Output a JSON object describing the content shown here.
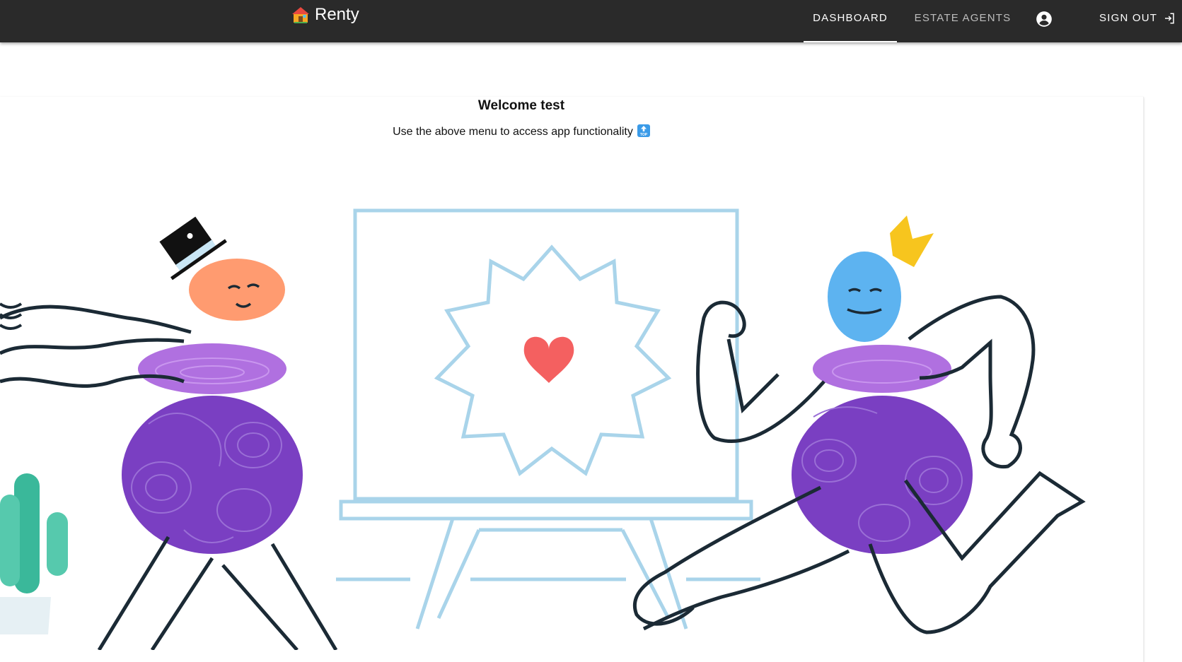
{
  "appbar": {
    "brand": "Renty",
    "brand_icon": "house-emoji",
    "tabs": [
      {
        "label": "Dashboard",
        "active": true
      },
      {
        "label": "Estate Agents",
        "active": false
      }
    ],
    "account_icon": "account-circle-icon",
    "signout_label": "Sign out",
    "signout_icon": "logout-icon"
  },
  "main": {
    "welcome": "Welcome test",
    "subtitle": "Use the above menu to access app functionality",
    "subtitle_icon": "top-arrow-emoji",
    "illustration": "celebration-illustration"
  },
  "colors": {
    "appbar_bg": "#2a2a2a",
    "orange_head": "#ff9b70",
    "blue_head": "#5db3f0",
    "purple_light": "#b070e0",
    "purple_dark": "#7a3fc2",
    "easel_blue": "#a9d4ea",
    "heart": "#f46060",
    "crown": "#f7c51e",
    "cactus": "#3ab89a"
  }
}
